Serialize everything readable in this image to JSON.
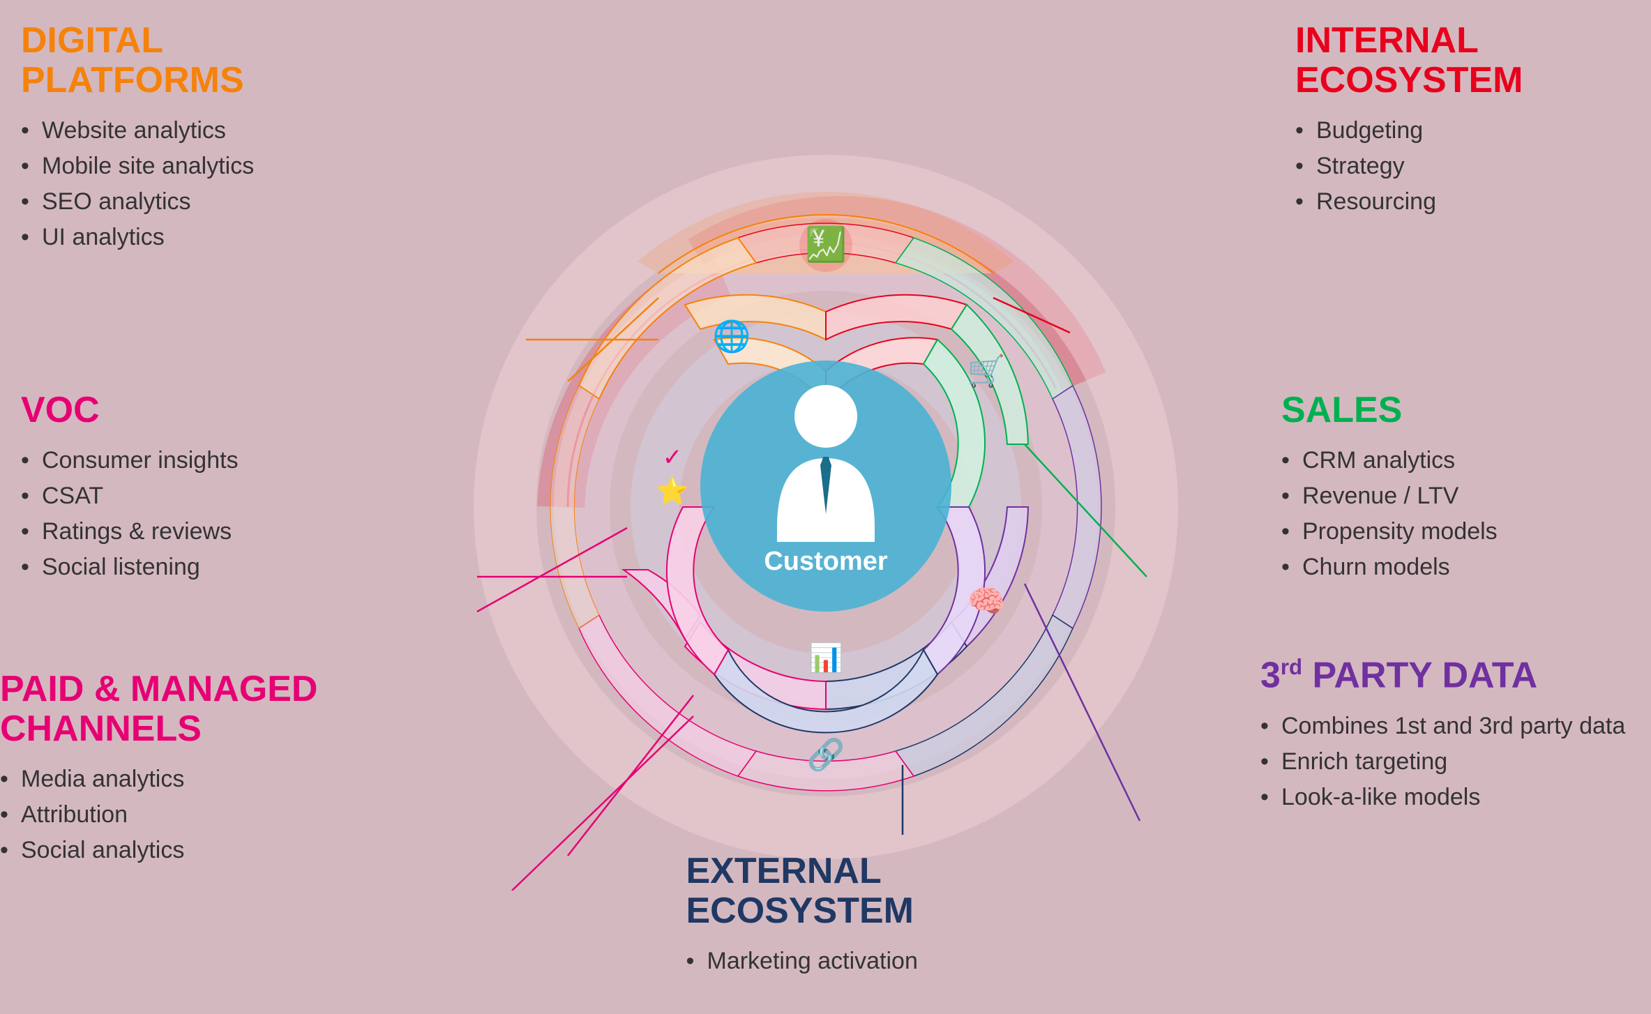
{
  "digital_platforms": {
    "title": "DIGITAL\nPLATFORMS",
    "color": "orange",
    "items": [
      "Website analytics",
      "Mobile site analytics",
      "SEO analytics",
      "UI analytics"
    ]
  },
  "voc": {
    "title": "VOC",
    "color": "magenta",
    "items": [
      "Consumer insights",
      "CSAT",
      "Ratings & reviews",
      "Social listening"
    ]
  },
  "paid_channels": {
    "title": "PAID & MANAGED\nCHANNELS",
    "color": "pink",
    "items": [
      "Media analytics",
      "Attribution",
      "Social analytics"
    ]
  },
  "internal_ecosystem": {
    "title": "INTERNAL\nECOSYSTEM",
    "color": "red",
    "items": [
      "Budgeting",
      "Strategy",
      "Resourcing"
    ]
  },
  "sales": {
    "title": "SALES",
    "color": "green",
    "items": [
      "CRM analytics",
      "Revenue / LTV",
      "Propensity models",
      "Churn models"
    ]
  },
  "third_party": {
    "title": "3rd PARTY DATA",
    "color": "purple",
    "items": [
      "Combines 1st and 3rd party data",
      "Enrich targeting",
      "Look-a-like models"
    ]
  },
  "external_ecosystem": {
    "title": "EXTERNAL\nECOSYSTEM",
    "color": "navy",
    "items": [
      "Marketing activation"
    ]
  },
  "center": {
    "label": "Customer"
  }
}
